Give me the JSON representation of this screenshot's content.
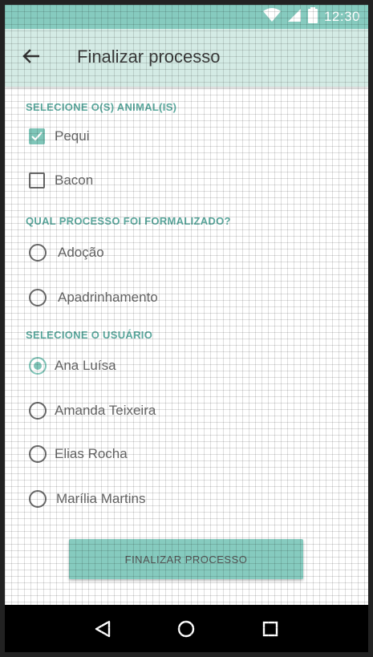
{
  "status_bar": {
    "time": "12:30",
    "icons": [
      "wifi-icon",
      "signal-icon",
      "battery-icon"
    ]
  },
  "app_bar": {
    "title": "Finalizar processo",
    "back_icon": "arrow-back-icon"
  },
  "animals_section": {
    "header": "SELECIONE O(S) ANIMAL(IS)",
    "items": [
      {
        "label": "Pequi",
        "checked": true
      },
      {
        "label": "Bacon",
        "checked": false
      }
    ]
  },
  "process_section": {
    "header": "QUAL PROCESSO FOI FORMALIZADO?",
    "items": [
      {
        "label": "Adoção",
        "selected": false
      },
      {
        "label": "Apadrinhamento",
        "selected": false
      }
    ]
  },
  "user_section": {
    "header": "SELECIONE O USUÁRIO",
    "items": [
      {
        "label": "Ana Luísa",
        "selected": true
      },
      {
        "label": "Amanda Teixeira",
        "selected": false
      },
      {
        "label": "Elias Rocha",
        "selected": false
      },
      {
        "label": "Marília Martins",
        "selected": false
      }
    ]
  },
  "submit_button": {
    "label": "FINALIZAR PROCESSO"
  },
  "nav_bar": {
    "icons": [
      "back-triangle-icon",
      "home-circle-icon",
      "recents-square-icon"
    ]
  },
  "colors": {
    "status_bar": "#86cbbf",
    "app_bar": "#d4ebe5",
    "accent": "#7fc6b9",
    "section_header": "#5aa89d"
  }
}
